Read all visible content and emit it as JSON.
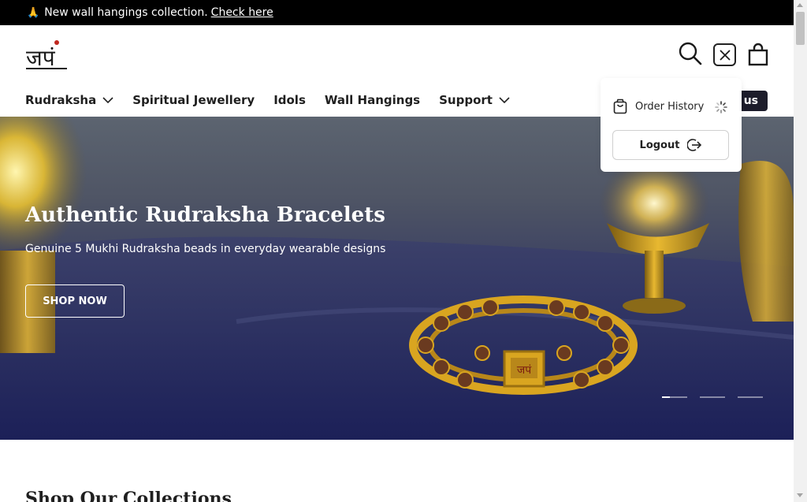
{
  "announcement": {
    "emoji": "🙏",
    "text": "New wall hangings collection.",
    "link": "Check here"
  },
  "header": {
    "logo_text": "जपं",
    "icons": [
      "search-icon",
      "close-icon",
      "bag-icon"
    ]
  },
  "nav": {
    "items": [
      {
        "label": "Rudraksha",
        "has_dropdown": true
      },
      {
        "label": "Spiritual Jewellery",
        "has_dropdown": false
      },
      {
        "label": "Idols",
        "has_dropdown": false
      },
      {
        "label": "Wall Hangings",
        "has_dropdown": false
      },
      {
        "label": "Support",
        "has_dropdown": true
      }
    ],
    "partial_button": "us"
  },
  "account_menu": {
    "order_history": "Order History",
    "logout": "Logout"
  },
  "hero": {
    "title": "Authentic Rudraksha Bracelets",
    "subtitle": "Genuine 5 Mukhi Rudraksha beads in everyday wearable designs",
    "cta": "SHOP NOW",
    "slide_count": 3,
    "active_slide": 1
  },
  "collections": {
    "title": "Shop Our Collections"
  },
  "colors": {
    "announcement_bg": "#000000",
    "accent_dark": "#1d1d2b",
    "logo_red": "#c0281f"
  }
}
